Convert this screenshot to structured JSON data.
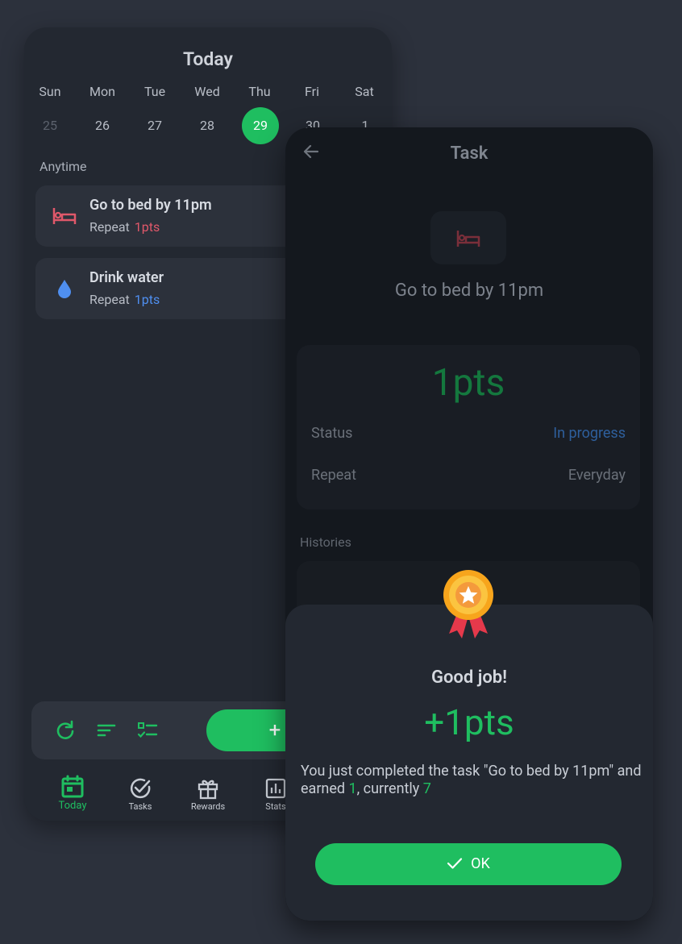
{
  "left": {
    "title": "Today",
    "days": [
      {
        "name": "Sun",
        "num": "25"
      },
      {
        "name": "Mon",
        "num": "26"
      },
      {
        "name": "Tue",
        "num": "27"
      },
      {
        "name": "Wed",
        "num": "28"
      },
      {
        "name": "Thu",
        "num": "29"
      },
      {
        "name": "Fri",
        "num": "30"
      },
      {
        "name": "Sat",
        "num": "1"
      }
    ],
    "selected_day": "29",
    "section": "Anytime",
    "tasks": [
      {
        "name": "Go to bed by 11pm",
        "repeat": "Repeat",
        "pts": "1pts",
        "icon": "bed-icon",
        "color": "#e0586a"
      },
      {
        "name": "Drink water",
        "repeat": "Repeat",
        "pts": "1pts",
        "icon": "water-drop-icon",
        "color": "#4f8ff0"
      }
    ],
    "toolbar": {
      "add": "+"
    },
    "nav": [
      {
        "label": "Today",
        "icon": "calendar-icon",
        "active": true
      },
      {
        "label": "Tasks",
        "icon": "check-circle-icon"
      },
      {
        "label": "Rewards",
        "icon": "gift-icon"
      },
      {
        "label": "Stats",
        "icon": "bar-chart-icon"
      }
    ],
    "accent": "#1fbe60"
  },
  "right": {
    "title": "Task",
    "task_name": "Go to bed by 11pm",
    "points": "1pts",
    "status_label": "Status",
    "status_value": "In progress",
    "repeat_label": "Repeat",
    "repeat_value": "Everyday",
    "histories_label": "Histories",
    "dialog": {
      "title": "Good job!",
      "points": "+1pts",
      "message_prefix": "You just completed the task \"Go to bed by 11pm\" and earned ",
      "earned": "1",
      "message_mid": ", currently ",
      "current": "7",
      "ok_label": "OK"
    }
  }
}
